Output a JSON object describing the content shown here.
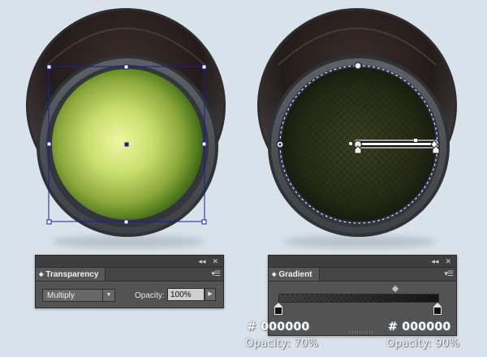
{
  "transparency_panel": {
    "tab_label": "Transparency",
    "blend_mode": "Multiply",
    "opacity_label": "Opacity:",
    "opacity_value": "100%",
    "collapse_icon": "double-chevron-left-icon",
    "close_icon": "close-icon",
    "menu_icon": "panel-menu-icon"
  },
  "gradient_panel": {
    "tab_label": "Gradient",
    "collapse_icon": "double-chevron-left-icon",
    "close_icon": "close-icon",
    "menu_icon": "panel-menu-icon",
    "stops": [
      {
        "color": "#000000",
        "opacity": 0.7,
        "location": 0
      },
      {
        "color": "#000000",
        "opacity": 0.9,
        "location": 1
      }
    ]
  },
  "annotations": {
    "left_hex": "# 000000",
    "left_opacity": "Opacity: 70%",
    "right_hex": "# 000000",
    "right_opacity": "Opacity: 90%"
  },
  "colors": {
    "background": "#d8e2ea",
    "selection": "#1a1aa8",
    "panel": "#535353",
    "glow_center": "#eef7a0",
    "glow_edge": "#3e6a14"
  }
}
